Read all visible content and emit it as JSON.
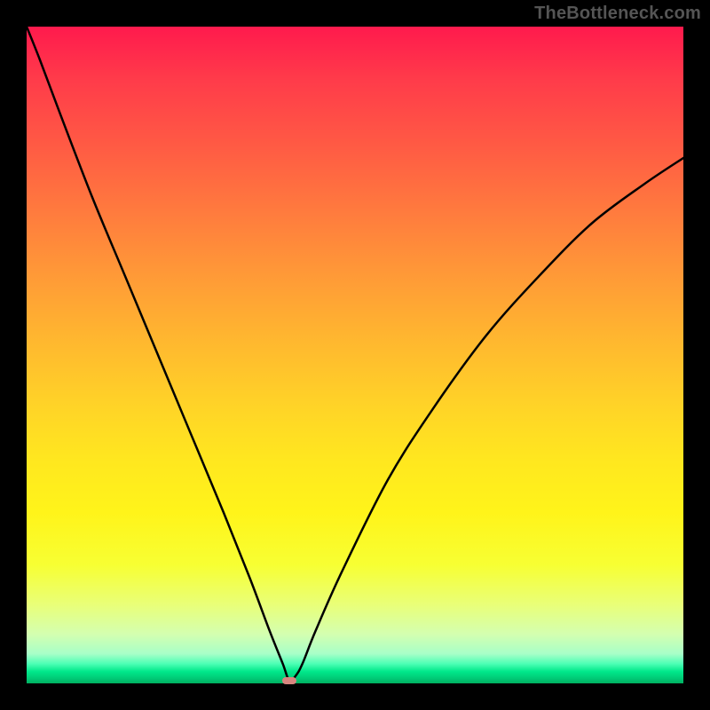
{
  "watermark": "TheBottleneck.com",
  "colors": {
    "frame": "#000000",
    "curve_stroke": "#000000",
    "kink": "#d8857f",
    "gradient_top": "#ff1a4d",
    "gradient_bottom": "#00b060"
  },
  "chart_data": {
    "type": "line",
    "title": "",
    "xlabel": "",
    "ylabel": "",
    "xlim": [
      0,
      100
    ],
    "ylim": [
      0,
      100
    ],
    "series": [
      {
        "name": "bottleneck-curve",
        "x": [
          0,
          2,
          5,
          10,
          15,
          20,
          25,
          30,
          34,
          37,
          39,
          40,
          41,
          42,
          44,
          48,
          55,
          62,
          70,
          78,
          86,
          94,
          100
        ],
        "y": [
          100,
          95,
          87,
          74,
          62,
          50,
          38,
          26,
          16,
          8,
          3,
          0.4,
          1.2,
          3,
          8,
          17,
          31,
          42,
          53,
          62,
          70,
          76,
          80
        ]
      }
    ],
    "annotations": [
      {
        "name": "kink-marker",
        "x": 40,
        "y": 0.4
      }
    ],
    "background": {
      "type": "vertical-gradient",
      "stops": [
        {
          "pos": 0,
          "color": "#ff1a4d"
        },
        {
          "pos": 0.5,
          "color": "#ffd427"
        },
        {
          "pos": 0.82,
          "color": "#f7ff33"
        },
        {
          "pos": 0.97,
          "color": "#4dffb5"
        },
        {
          "pos": 1.0,
          "color": "#00b060"
        }
      ]
    }
  }
}
